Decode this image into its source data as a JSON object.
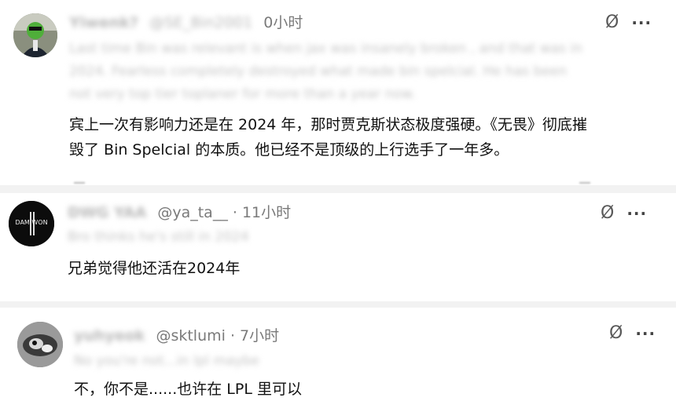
{
  "posts": [
    {
      "handle": "",
      "time": "0小时",
      "blurred_name": "Yiwenk?",
      "blurred_handle": "@SE_Bin2001",
      "blurred_original": [
        "Last time Bin was relevant is when jax was insanely broken , and that was in",
        "2024. Fearless completely destroyed what made bin spelcial. He has been",
        "not very top tier toplaner for more than a year now."
      ],
      "translation": [
        "宾上一次有影响力还是在 2024 年，那时贾克斯状态极度强硬。《无畏》彻底摧",
        "毁了 Bin Spelcial 的本质。他已经不是顶级的上行选手了一年多。"
      ]
    },
    {
      "handle": "@ya_ta__",
      "time": "· 11小时",
      "blurred_name": "DWG YAA",
      "blurred_original": [
        "Bro thinks he's still in 2024"
      ],
      "translation": [
        "兄弟觉得他还活在2024年"
      ],
      "avatar_text": "DAM WON"
    },
    {
      "handle": "@sktlumi",
      "time": "· 7小时",
      "blurred_name": "yuhyeok",
      "blurred_original": [
        "No you're not...in lpl maybe"
      ],
      "translation": [
        "不，你不是......也许在 LPL 里可以"
      ]
    }
  ],
  "icons": {
    "mute": "mute-icon",
    "more": "more-icon"
  },
  "more_glyph": "···",
  "mute_glyph": "Ø",
  "colors": {
    "translation": "#111111",
    "meta": "#7a7a7a",
    "separator": "#f2f2f2"
  }
}
